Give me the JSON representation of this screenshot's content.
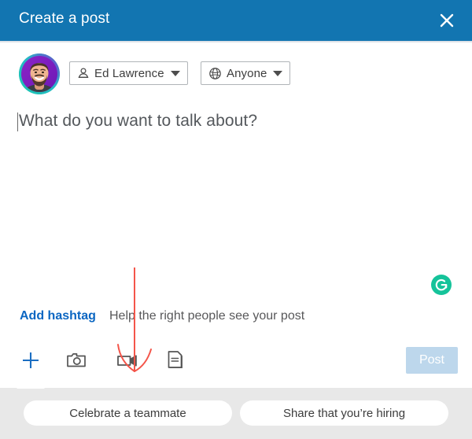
{
  "header": {
    "title": "Create a post",
    "close_icon": "close-icon",
    "background_color": "#1275b1"
  },
  "identity": {
    "avatar_name": "avatar",
    "author": {
      "icon": "person-icon",
      "label": "Ed Lawrence",
      "caret": "chevron-down-icon"
    },
    "audience": {
      "icon": "globe-icon",
      "label": "Anyone",
      "caret": "chevron-down-icon"
    }
  },
  "editor": {
    "placeholder": "What do you want to talk about?",
    "value": "",
    "caret_visible": true,
    "assistant_icon": "grammarly-icon",
    "assistant_color": "#15c39a"
  },
  "hashtag": {
    "link_label": "Add hashtag",
    "hint": "Help the right people see your post",
    "link_color": "#0a66c2"
  },
  "actions": {
    "tools": [
      {
        "name": "add-icon",
        "label": "Add"
      },
      {
        "name": "photo-icon",
        "label": "Add a photo"
      },
      {
        "name": "video-icon",
        "label": "Add a video"
      },
      {
        "name": "document-icon",
        "label": "Add a document"
      }
    ],
    "post_label": "Post",
    "post_enabled": false,
    "post_color": "#bdd7ec"
  },
  "suggestions": {
    "items": [
      {
        "label": "Celebrate a teammate"
      },
      {
        "label": "Share that you’re hiring"
      }
    ],
    "background_color": "#e8e8e8"
  },
  "annotation": {
    "name": "red-arrow-annotation",
    "color": "#f4554a",
    "points_at": "video-icon"
  }
}
